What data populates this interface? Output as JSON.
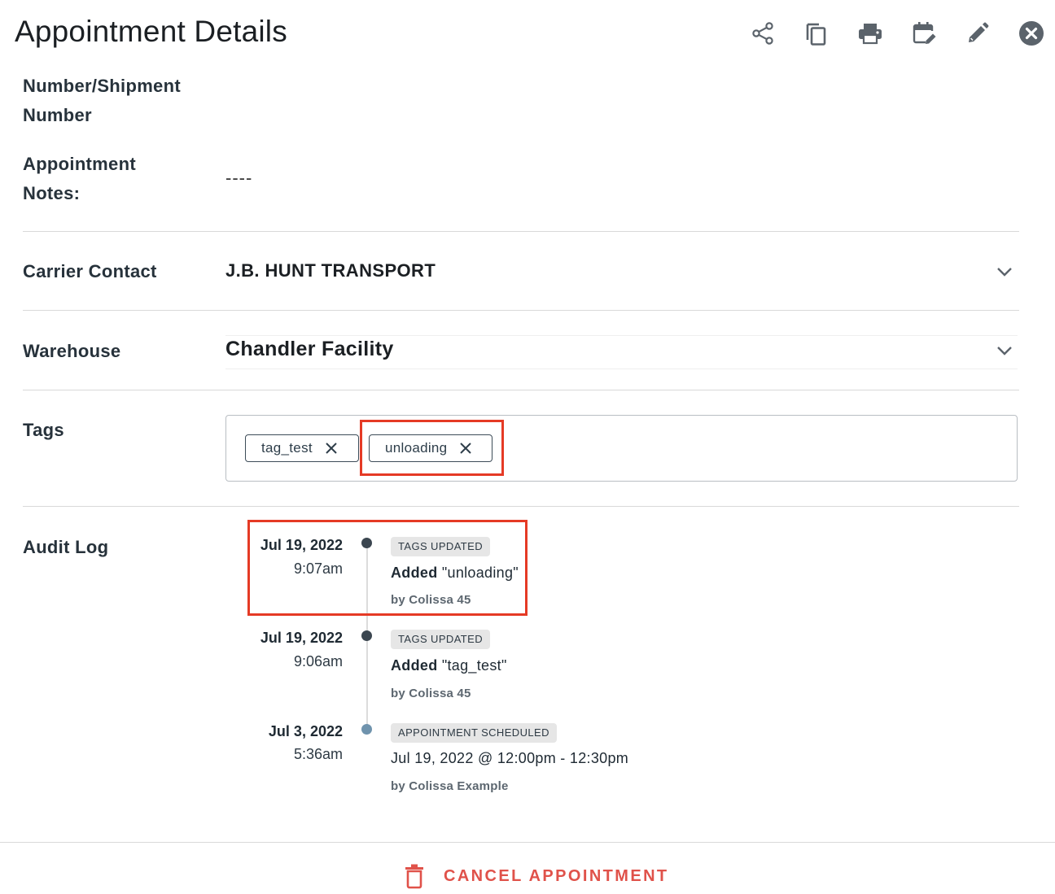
{
  "header": {
    "title": "Appointment Details",
    "actions": [
      {
        "name": "share",
        "icon": "share-icon"
      },
      {
        "name": "duplicate",
        "icon": "copy-icon"
      },
      {
        "name": "print",
        "icon": "print-icon"
      },
      {
        "name": "reschedule",
        "icon": "calendar-edit-icon"
      },
      {
        "name": "edit",
        "icon": "pencil-icon"
      },
      {
        "name": "close",
        "icon": "close-circle-icon"
      }
    ]
  },
  "fields": {
    "shipment_label_line1": "Number/Shipment",
    "shipment_label_line2": "Number",
    "notes_label_line1": "Appointment",
    "notes_label_line2": "Notes:",
    "notes_value": "----",
    "carrier_label": "Carrier Contact",
    "carrier_value": "J.B. HUNT TRANSPORT",
    "warehouse_label": "Warehouse",
    "warehouse_value": "Chandler Facility",
    "tags_label": "Tags",
    "audit_label": "Audit Log"
  },
  "tags": [
    "tag_test",
    "unloading"
  ],
  "audit_log": [
    {
      "date": "Jul 19, 2022",
      "time": "9:07am",
      "badge": "TAGS UPDATED",
      "action": "Added",
      "detail": "\"unloading\"",
      "by": "by Colissa 45"
    },
    {
      "date": "Jul 19, 2022",
      "time": "9:06am",
      "badge": "TAGS UPDATED",
      "action": "Added",
      "detail": "\"tag_test\"",
      "by": "by Colissa 45"
    },
    {
      "date": "Jul 3, 2022",
      "time": "5:36am",
      "badge": "APPOINTMENT SCHEDULED",
      "action": "",
      "detail": "Jul 19, 2022 @ 12:00pm - 12:30pm",
      "by": "by Colissa Example"
    }
  ],
  "footer": {
    "cancel_label": "CANCEL APPOINTMENT",
    "cancel_icon": "trash-icon"
  },
  "colors": {
    "accent_danger": "#e0524a",
    "highlight_box": "#e53a25",
    "dot_dark": "#3b4650",
    "dot_light": "#6f93ad"
  }
}
